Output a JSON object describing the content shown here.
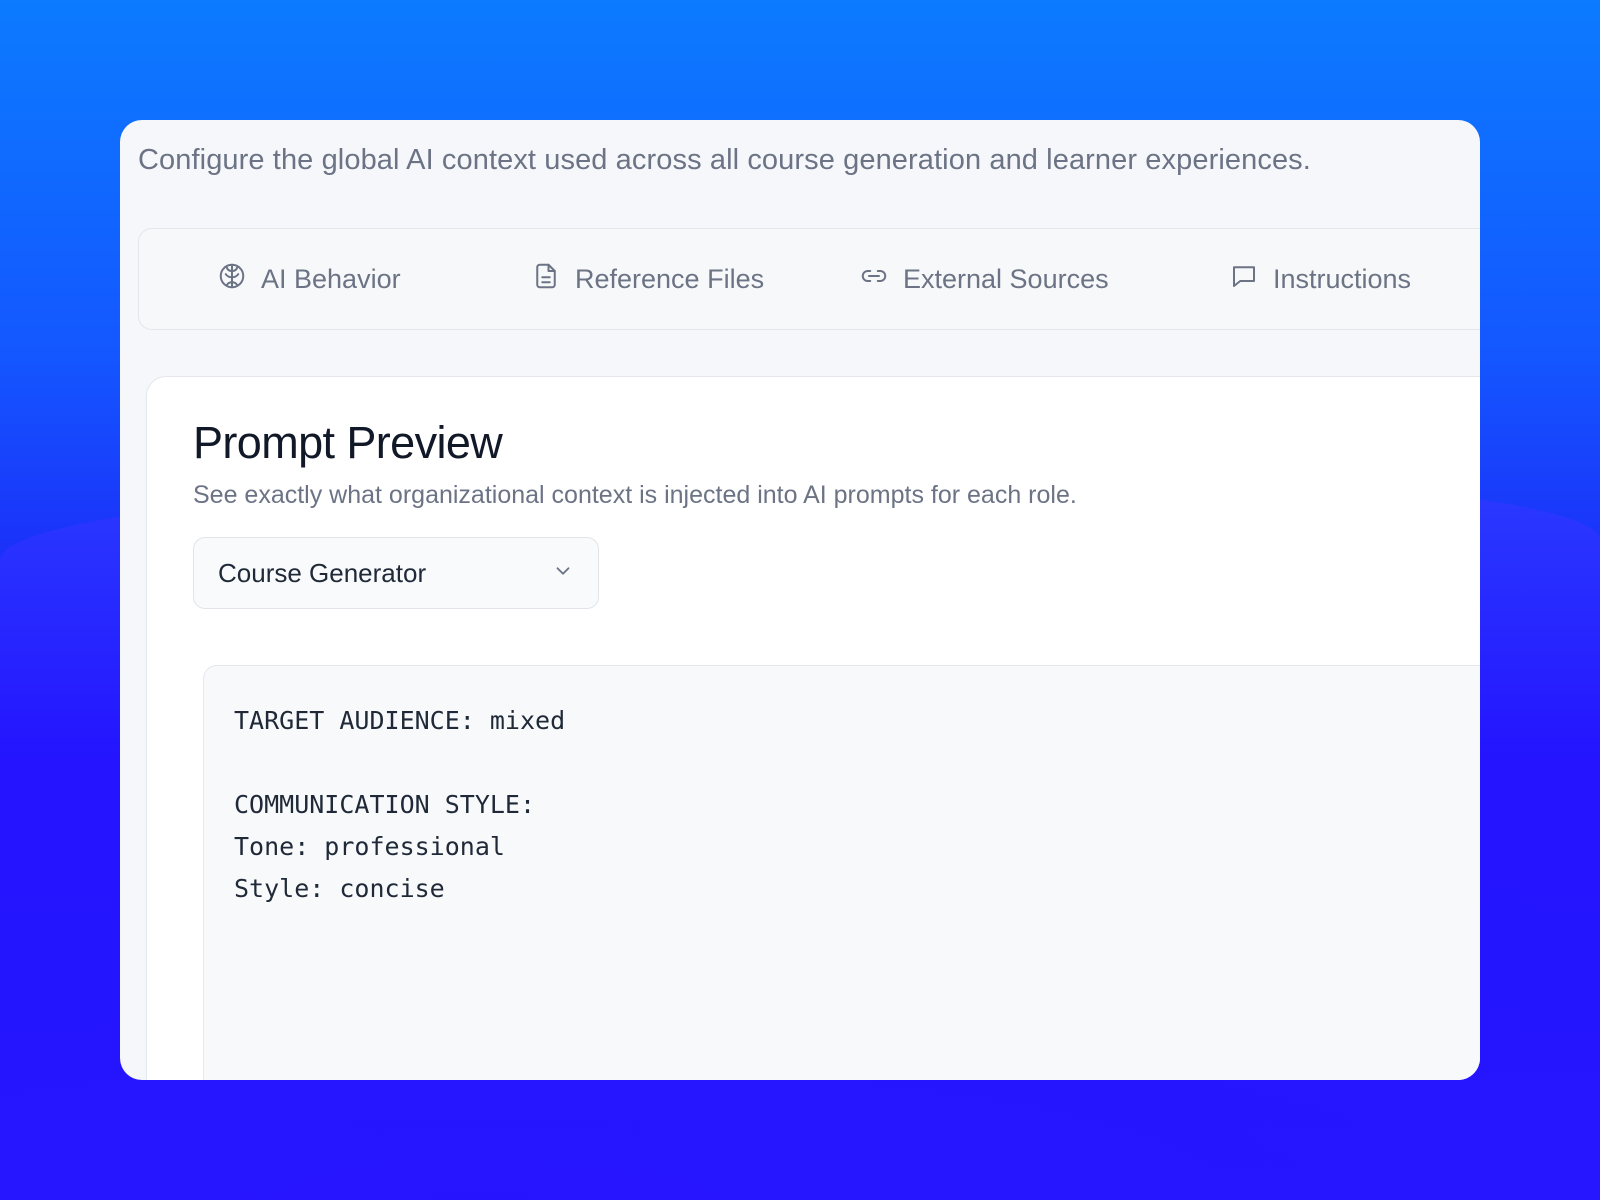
{
  "page": {
    "subtitle": "Configure the global AI context used across all course generation and learner experiences."
  },
  "tabs": [
    {
      "label": "AI Behavior",
      "icon": "brain-icon"
    },
    {
      "label": "Reference Files",
      "icon": "file-icon"
    },
    {
      "label": "External Sources",
      "icon": "link-icon"
    },
    {
      "label": "Instructions",
      "icon": "message-icon"
    }
  ],
  "preview": {
    "title": "Prompt Preview",
    "description": "See exactly what organizational context is injected into AI prompts for each role.",
    "role_select": {
      "value": "Course Generator"
    },
    "code_lines": [
      "TARGET AUDIENCE: mixed",
      "",
      "COMMUNICATION STYLE:",
      "Tone: professional",
      "Style: concise"
    ]
  },
  "colors": {
    "accent_background": "#1f1cf5",
    "muted_text": "#6b7385",
    "heading_text": "#111827"
  }
}
